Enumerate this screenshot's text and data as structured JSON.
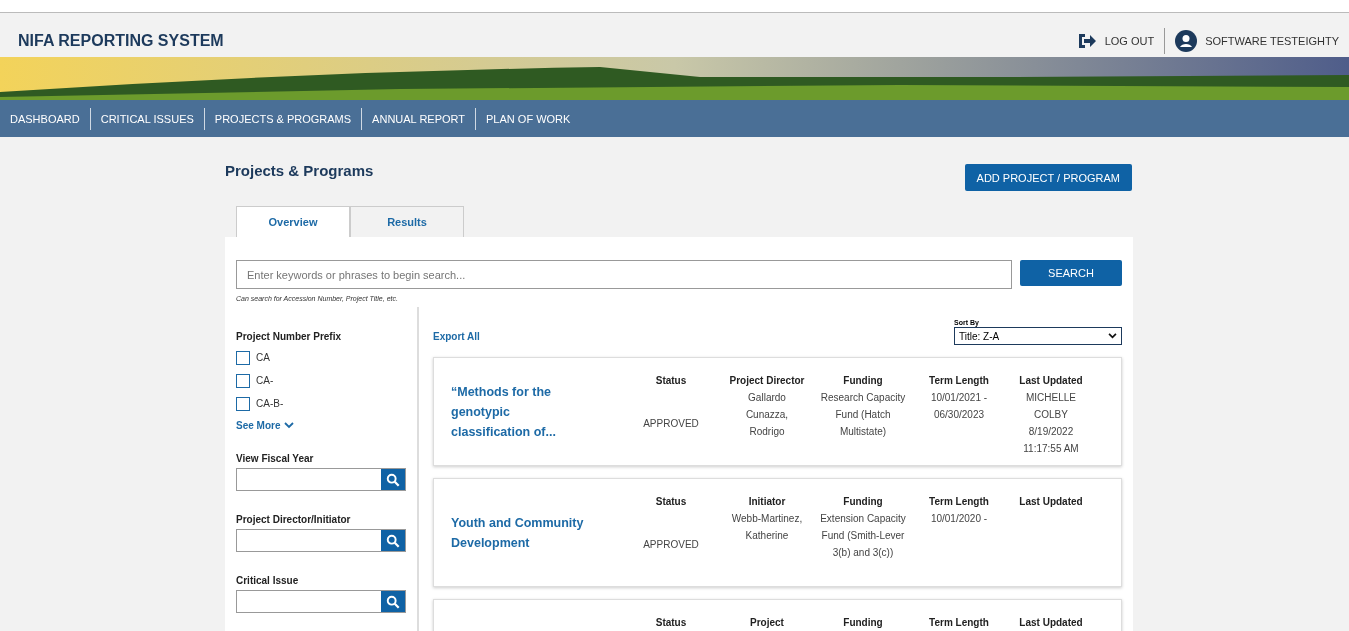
{
  "header": {
    "title": "NIFA REPORTING SYSTEM",
    "logout": "LOG OUT",
    "user": "SOFTWARE TESTEIGHTY"
  },
  "nav": [
    {
      "label": "DASHBOARD",
      "selected": false
    },
    {
      "label": "CRITICAL ISSUES",
      "selected": false
    },
    {
      "label": "PROJECTS & PROGRAMS",
      "selected": false
    },
    {
      "label": "ANNUAL REPORT",
      "selected": false
    },
    {
      "label": "PLAN OF WORK",
      "selected": false
    }
  ],
  "page_title": "Projects & Programs",
  "add_button": "ADD PROJECT / PROGRAM",
  "tabs": [
    {
      "label": "Overview",
      "selected": true
    },
    {
      "label": "Results",
      "selected": false
    }
  ],
  "search": {
    "placeholder": "Enter keywords or phrases to begin search...",
    "button": "SEARCH",
    "hint": "Can search for Accession Number, Project Title, etc."
  },
  "filters": {
    "prefix_title": "Project Number Prefix",
    "prefixes": [
      {
        "label": "CA",
        "checked": false
      },
      {
        "label": "CA-",
        "checked": false
      },
      {
        "label": "CA-B-",
        "checked": false
      }
    ],
    "see_more": "See More",
    "fields": [
      {
        "label": "View Fiscal Year"
      },
      {
        "label": "Project Director/Initiator"
      },
      {
        "label": "Critical Issue"
      }
    ]
  },
  "export_all": "Export All",
  "sort": {
    "label": "Sort By",
    "value": "Title: Z-A"
  },
  "projects": [
    {
      "title": "“Methods for the genotypic classification of...",
      "columns": [
        {
          "heading": "Status",
          "value": "APPROVED"
        },
        {
          "heading": "Project Director",
          "value": "Gallardo Cunazza, Rodrigo"
        },
        {
          "heading": "Funding",
          "value": "Research Capacity Fund (Hatch Multistate)"
        },
        {
          "heading": "Term Length",
          "value": "10/01/2021 - 06/30/2023"
        },
        {
          "heading": "Last Updated",
          "value": "MICHELLE COLBY 8/19/2022 11:17:55 AM"
        }
      ]
    },
    {
      "title": "Youth and Community Development",
      "columns": [
        {
          "heading": "Status",
          "value": "APPROVED"
        },
        {
          "heading": "Initiator",
          "value": "Webb-Martinez, Katherine"
        },
        {
          "heading": "Funding",
          "value": "Extension Capacity Fund (Smith-Lever 3(b) and 3(c))"
        },
        {
          "heading": "Term Length",
          "value": "10/01/2020 -"
        },
        {
          "heading": "Last Updated"
        }
      ]
    },
    {
      "columns": [
        {
          "heading": "Status"
        },
        {
          "heading": "Project"
        },
        {
          "heading": "Funding"
        },
        {
          "heading": "Term Length"
        },
        {
          "heading": "Last Updated"
        }
      ]
    }
  ]
}
